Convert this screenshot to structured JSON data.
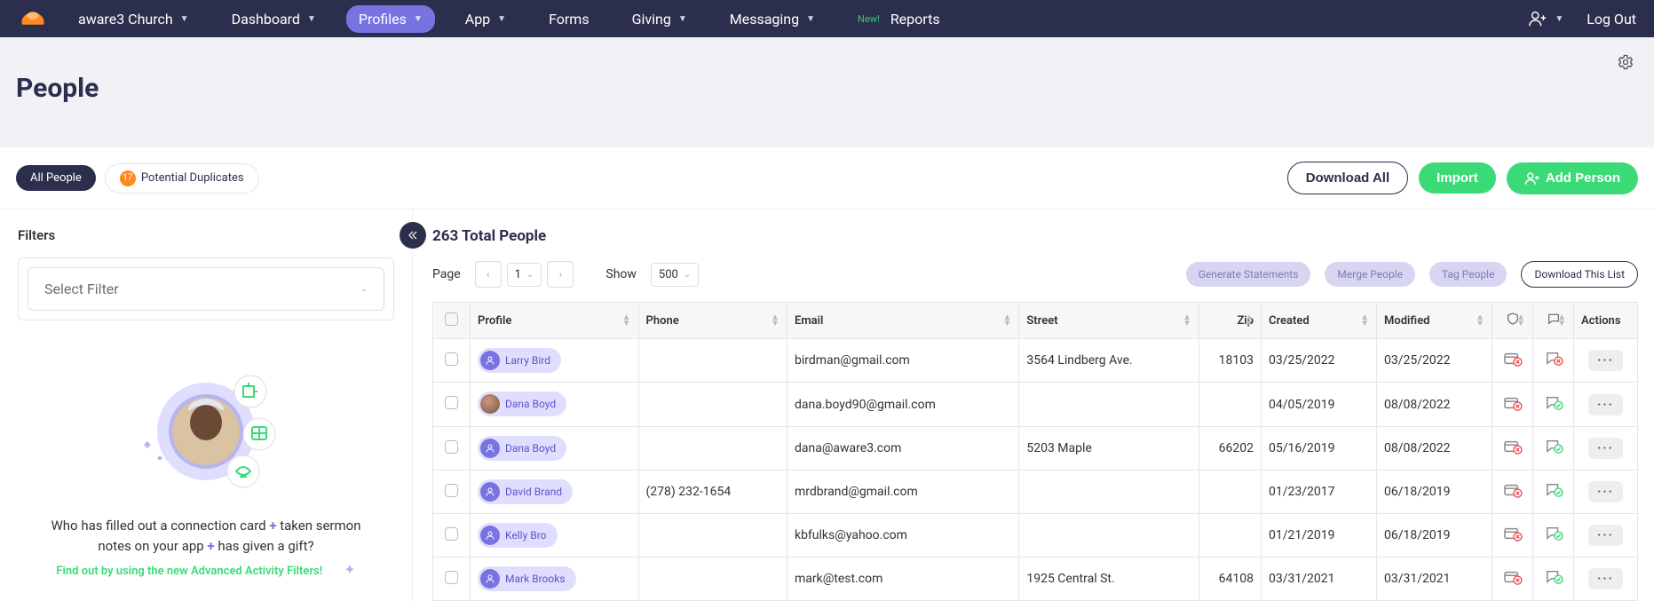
{
  "nav": {
    "org": "aware3 Church",
    "items": [
      "Dashboard",
      "Profiles",
      "App",
      "Forms",
      "Giving",
      "Messaging"
    ],
    "active_index": 1,
    "new_tag": "New!",
    "reports": "Reports",
    "logout": "Log Out"
  },
  "page": {
    "title": "People"
  },
  "tabs": {
    "all": "All People",
    "dup_count": "17",
    "dup_label": "Potential Duplicates"
  },
  "actions": {
    "download_all": "Download All",
    "import": "Import",
    "add_person": "Add Person"
  },
  "sidebar": {
    "filters_heading": "Filters",
    "select_placeholder": "Select Filter",
    "promo_line1_a": "Who has filled out a connection card ",
    "promo_line1_b": " taken sermon",
    "promo_line2_a": "notes on your app ",
    "promo_line2_b": " has given a gift?",
    "promo_cta": "Find out by using the new Advanced Activity Filters!"
  },
  "content_header": {
    "total": "263 Total People",
    "page_label": "Page",
    "page_value": "1",
    "show_label": "Show",
    "show_value": "500",
    "gen_statements": "Generate Statements",
    "merge": "Merge People",
    "tag": "Tag People",
    "dl_list": "Download This List"
  },
  "columns": {
    "profile": "Profile",
    "phone": "Phone",
    "email": "Email",
    "street": "Street",
    "zip": "Zip",
    "created": "Created",
    "modified": "Modified",
    "actions": "Actions"
  },
  "rows": [
    {
      "name": "Larry Bird",
      "phone": "",
      "email": "birdman@gmail.com",
      "street": "3564 Lindberg Ave.",
      "zip": "18103",
      "created": "03/25/2022",
      "modified": "03/25/2022",
      "photo": false,
      "giving": false,
      "comm": false
    },
    {
      "name": "Dana Boyd",
      "phone": "",
      "email": "dana.boyd90@gmail.com",
      "street": "",
      "zip": "",
      "created": "04/05/2019",
      "modified": "08/08/2022",
      "photo": true,
      "giving": false,
      "comm": true
    },
    {
      "name": "Dana Boyd",
      "phone": "",
      "email": "dana@aware3.com",
      "street": "5203 Maple",
      "zip": "66202",
      "created": "05/16/2019",
      "modified": "08/08/2022",
      "photo": false,
      "giving": false,
      "comm": true
    },
    {
      "name": "David Brand",
      "phone": "(278) 232-1654",
      "email": "mrdbrand@gmail.com",
      "street": "",
      "zip": "",
      "created": "01/23/2017",
      "modified": "06/18/2019",
      "photo": false,
      "giving": false,
      "comm": true
    },
    {
      "name": "Kelly Bro",
      "phone": "",
      "email": "kbfulks@yahoo.com",
      "street": "",
      "zip": "",
      "created": "01/21/2019",
      "modified": "06/18/2019",
      "photo": false,
      "giving": false,
      "comm": true
    },
    {
      "name": "Mark Brooks",
      "phone": "",
      "email": "mark@test.com",
      "street": "1925 Central St.",
      "zip": "64108",
      "created": "03/31/2021",
      "modified": "03/31/2021",
      "photo": false,
      "giving": false,
      "comm": true
    }
  ]
}
